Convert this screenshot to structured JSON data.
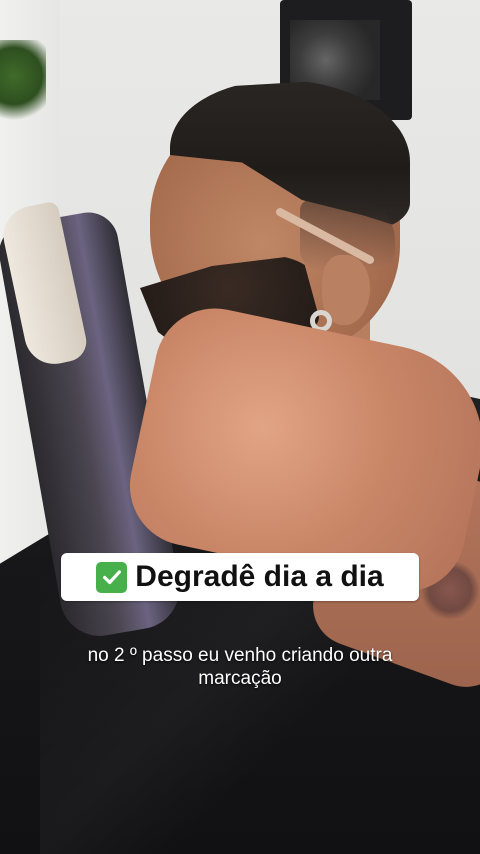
{
  "overlay": {
    "title": "Degradê dia a dia",
    "title_icon": "check-mark-button-icon",
    "title_icon_color": "#47b04b"
  },
  "caption": {
    "line1": "no 2 º  passo eu venho criando outra",
    "line2": "marcação"
  }
}
